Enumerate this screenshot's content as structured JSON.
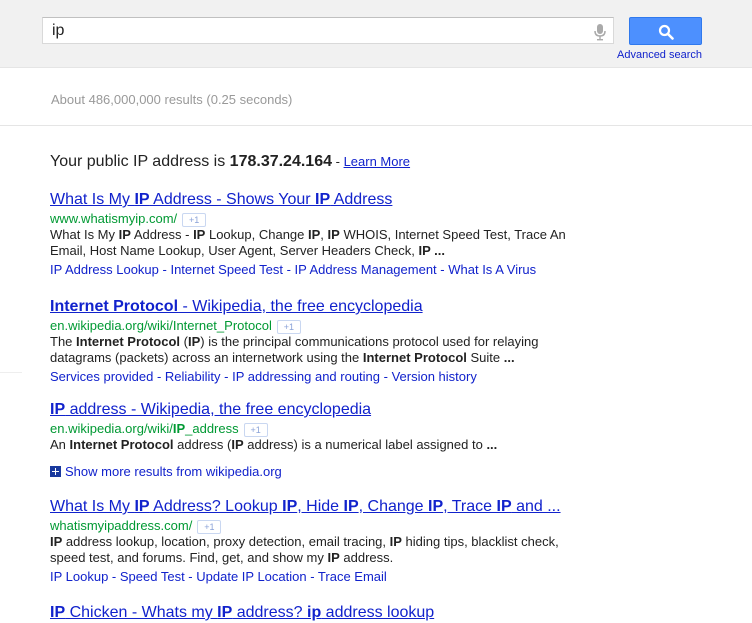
{
  "search": {
    "query": "ip",
    "advanced_label": "Advanced search"
  },
  "colors": {
    "brand_blue": "#4d90fe",
    "link": "#1122cc",
    "url_green": "#009933"
  },
  "stats": "About 486,000,000 results (0.25 seconds)",
  "ip_answer": {
    "prefix": "Your public IP address is ",
    "ip": "178.37.24.164",
    "sep": " - ",
    "learn_more": "Learn More"
  },
  "results": [
    {
      "title": [
        "What Is My ",
        "IP",
        " Address - Shows Your ",
        "IP",
        " Address"
      ],
      "url": "www.whatismyip.com/",
      "plus_one": "+1",
      "snippet": [
        "What Is My ",
        "IP",
        " Address - ",
        "IP",
        " Lookup, Change ",
        "IP",
        ", ",
        "IP",
        " WHOIS, Internet Speed Test, Trace An Email, Host Name Lookup, User Agent, Server Headers Check, ",
        "IP ..."
      ],
      "sitelinks": [
        "IP Address Lookup",
        "Internet Speed Test",
        "IP Address Management",
        "What Is A Virus"
      ]
    },
    {
      "title": [
        "Internet Protocol",
        " - Wikipedia, the free encyclopedia"
      ],
      "url": "en.wikipedia.org/wiki/Internet_Protocol",
      "plus_one": "+1",
      "snippet": [
        "The ",
        "Internet Protocol",
        " (",
        "IP",
        ") is the principal communications protocol used for relaying datagrams (packets) across an internetwork using the ",
        "Internet Protocol",
        " Suite ",
        "..."
      ],
      "sitelinks": [
        "Services provided",
        "Reliability",
        "IP addressing and routing",
        "Version history"
      ]
    },
    {
      "title": [
        "IP",
        " address - Wikipedia, the free encyclopedia"
      ],
      "url_parts": [
        "en.wikipedia.org/wiki/",
        "IP",
        "_address"
      ],
      "plus_one": "+1",
      "snippet": [
        "An ",
        "Internet Protocol",
        " address (",
        "IP",
        " address) is a numerical label assigned to ",
        "..."
      ]
    },
    {
      "title": [
        "What Is My ",
        "IP",
        " Address? Lookup ",
        "IP",
        ", Hide ",
        "IP",
        ", Change ",
        "IP",
        ", Trace ",
        "IP",
        " and ..."
      ],
      "url": "whatismyipaddress.com/",
      "plus_one": "+1",
      "snippet": [
        "IP",
        " address lookup, location, proxy detection, email tracing, ",
        "IP",
        " hiding tips, blacklist check, speed test, and forums. Find, get, and show my ",
        "IP",
        " address."
      ],
      "sitelinks": [
        "IP Lookup",
        "Speed Test",
        "Update IP Location",
        "Trace Email"
      ]
    },
    {
      "title": [
        "IP",
        " Chicken - Whats my ",
        "IP",
        " address? ",
        "ip",
        " address lookup"
      ]
    }
  ],
  "more_results": "Show more results from wikipedia.org",
  "link_sep": " - "
}
